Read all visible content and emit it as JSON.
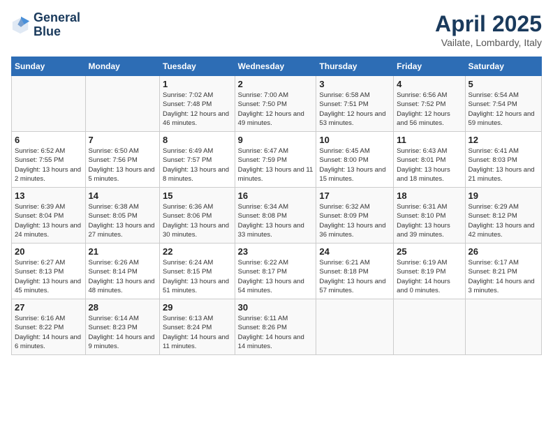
{
  "header": {
    "logo_line1": "General",
    "logo_line2": "Blue",
    "title": "April 2025",
    "subtitle": "Vailate, Lombardy, Italy"
  },
  "columns": [
    "Sunday",
    "Monday",
    "Tuesday",
    "Wednesday",
    "Thursday",
    "Friday",
    "Saturday"
  ],
  "weeks": [
    [
      {
        "day": "",
        "sunrise": "",
        "sunset": "",
        "daylight": ""
      },
      {
        "day": "",
        "sunrise": "",
        "sunset": "",
        "daylight": ""
      },
      {
        "day": "1",
        "sunrise": "Sunrise: 7:02 AM",
        "sunset": "Sunset: 7:48 PM",
        "daylight": "Daylight: 12 hours and 46 minutes."
      },
      {
        "day": "2",
        "sunrise": "Sunrise: 7:00 AM",
        "sunset": "Sunset: 7:50 PM",
        "daylight": "Daylight: 12 hours and 49 minutes."
      },
      {
        "day": "3",
        "sunrise": "Sunrise: 6:58 AM",
        "sunset": "Sunset: 7:51 PM",
        "daylight": "Daylight: 12 hours and 53 minutes."
      },
      {
        "day": "4",
        "sunrise": "Sunrise: 6:56 AM",
        "sunset": "Sunset: 7:52 PM",
        "daylight": "Daylight: 12 hours and 56 minutes."
      },
      {
        "day": "5",
        "sunrise": "Sunrise: 6:54 AM",
        "sunset": "Sunset: 7:54 PM",
        "daylight": "Daylight: 12 hours and 59 minutes."
      }
    ],
    [
      {
        "day": "6",
        "sunrise": "Sunrise: 6:52 AM",
        "sunset": "Sunset: 7:55 PM",
        "daylight": "Daylight: 13 hours and 2 minutes."
      },
      {
        "day": "7",
        "sunrise": "Sunrise: 6:50 AM",
        "sunset": "Sunset: 7:56 PM",
        "daylight": "Daylight: 13 hours and 5 minutes."
      },
      {
        "day": "8",
        "sunrise": "Sunrise: 6:49 AM",
        "sunset": "Sunset: 7:57 PM",
        "daylight": "Daylight: 13 hours and 8 minutes."
      },
      {
        "day": "9",
        "sunrise": "Sunrise: 6:47 AM",
        "sunset": "Sunset: 7:59 PM",
        "daylight": "Daylight: 13 hours and 11 minutes."
      },
      {
        "day": "10",
        "sunrise": "Sunrise: 6:45 AM",
        "sunset": "Sunset: 8:00 PM",
        "daylight": "Daylight: 13 hours and 15 minutes."
      },
      {
        "day": "11",
        "sunrise": "Sunrise: 6:43 AM",
        "sunset": "Sunset: 8:01 PM",
        "daylight": "Daylight: 13 hours and 18 minutes."
      },
      {
        "day": "12",
        "sunrise": "Sunrise: 6:41 AM",
        "sunset": "Sunset: 8:03 PM",
        "daylight": "Daylight: 13 hours and 21 minutes."
      }
    ],
    [
      {
        "day": "13",
        "sunrise": "Sunrise: 6:39 AM",
        "sunset": "Sunset: 8:04 PM",
        "daylight": "Daylight: 13 hours and 24 minutes."
      },
      {
        "day": "14",
        "sunrise": "Sunrise: 6:38 AM",
        "sunset": "Sunset: 8:05 PM",
        "daylight": "Daylight: 13 hours and 27 minutes."
      },
      {
        "day": "15",
        "sunrise": "Sunrise: 6:36 AM",
        "sunset": "Sunset: 8:06 PM",
        "daylight": "Daylight: 13 hours and 30 minutes."
      },
      {
        "day": "16",
        "sunrise": "Sunrise: 6:34 AM",
        "sunset": "Sunset: 8:08 PM",
        "daylight": "Daylight: 13 hours and 33 minutes."
      },
      {
        "day": "17",
        "sunrise": "Sunrise: 6:32 AM",
        "sunset": "Sunset: 8:09 PM",
        "daylight": "Daylight: 13 hours and 36 minutes."
      },
      {
        "day": "18",
        "sunrise": "Sunrise: 6:31 AM",
        "sunset": "Sunset: 8:10 PM",
        "daylight": "Daylight: 13 hours and 39 minutes."
      },
      {
        "day": "19",
        "sunrise": "Sunrise: 6:29 AM",
        "sunset": "Sunset: 8:12 PM",
        "daylight": "Daylight: 13 hours and 42 minutes."
      }
    ],
    [
      {
        "day": "20",
        "sunrise": "Sunrise: 6:27 AM",
        "sunset": "Sunset: 8:13 PM",
        "daylight": "Daylight: 13 hours and 45 minutes."
      },
      {
        "day": "21",
        "sunrise": "Sunrise: 6:26 AM",
        "sunset": "Sunset: 8:14 PM",
        "daylight": "Daylight: 13 hours and 48 minutes."
      },
      {
        "day": "22",
        "sunrise": "Sunrise: 6:24 AM",
        "sunset": "Sunset: 8:15 PM",
        "daylight": "Daylight: 13 hours and 51 minutes."
      },
      {
        "day": "23",
        "sunrise": "Sunrise: 6:22 AM",
        "sunset": "Sunset: 8:17 PM",
        "daylight": "Daylight: 13 hours and 54 minutes."
      },
      {
        "day": "24",
        "sunrise": "Sunrise: 6:21 AM",
        "sunset": "Sunset: 8:18 PM",
        "daylight": "Daylight: 13 hours and 57 minutes."
      },
      {
        "day": "25",
        "sunrise": "Sunrise: 6:19 AM",
        "sunset": "Sunset: 8:19 PM",
        "daylight": "Daylight: 14 hours and 0 minutes."
      },
      {
        "day": "26",
        "sunrise": "Sunrise: 6:17 AM",
        "sunset": "Sunset: 8:21 PM",
        "daylight": "Daylight: 14 hours and 3 minutes."
      }
    ],
    [
      {
        "day": "27",
        "sunrise": "Sunrise: 6:16 AM",
        "sunset": "Sunset: 8:22 PM",
        "daylight": "Daylight: 14 hours and 6 minutes."
      },
      {
        "day": "28",
        "sunrise": "Sunrise: 6:14 AM",
        "sunset": "Sunset: 8:23 PM",
        "daylight": "Daylight: 14 hours and 9 minutes."
      },
      {
        "day": "29",
        "sunrise": "Sunrise: 6:13 AM",
        "sunset": "Sunset: 8:24 PM",
        "daylight": "Daylight: 14 hours and 11 minutes."
      },
      {
        "day": "30",
        "sunrise": "Sunrise: 6:11 AM",
        "sunset": "Sunset: 8:26 PM",
        "daylight": "Daylight: 14 hours and 14 minutes."
      },
      {
        "day": "",
        "sunrise": "",
        "sunset": "",
        "daylight": ""
      },
      {
        "day": "",
        "sunrise": "",
        "sunset": "",
        "daylight": ""
      },
      {
        "day": "",
        "sunrise": "",
        "sunset": "",
        "daylight": ""
      }
    ]
  ]
}
